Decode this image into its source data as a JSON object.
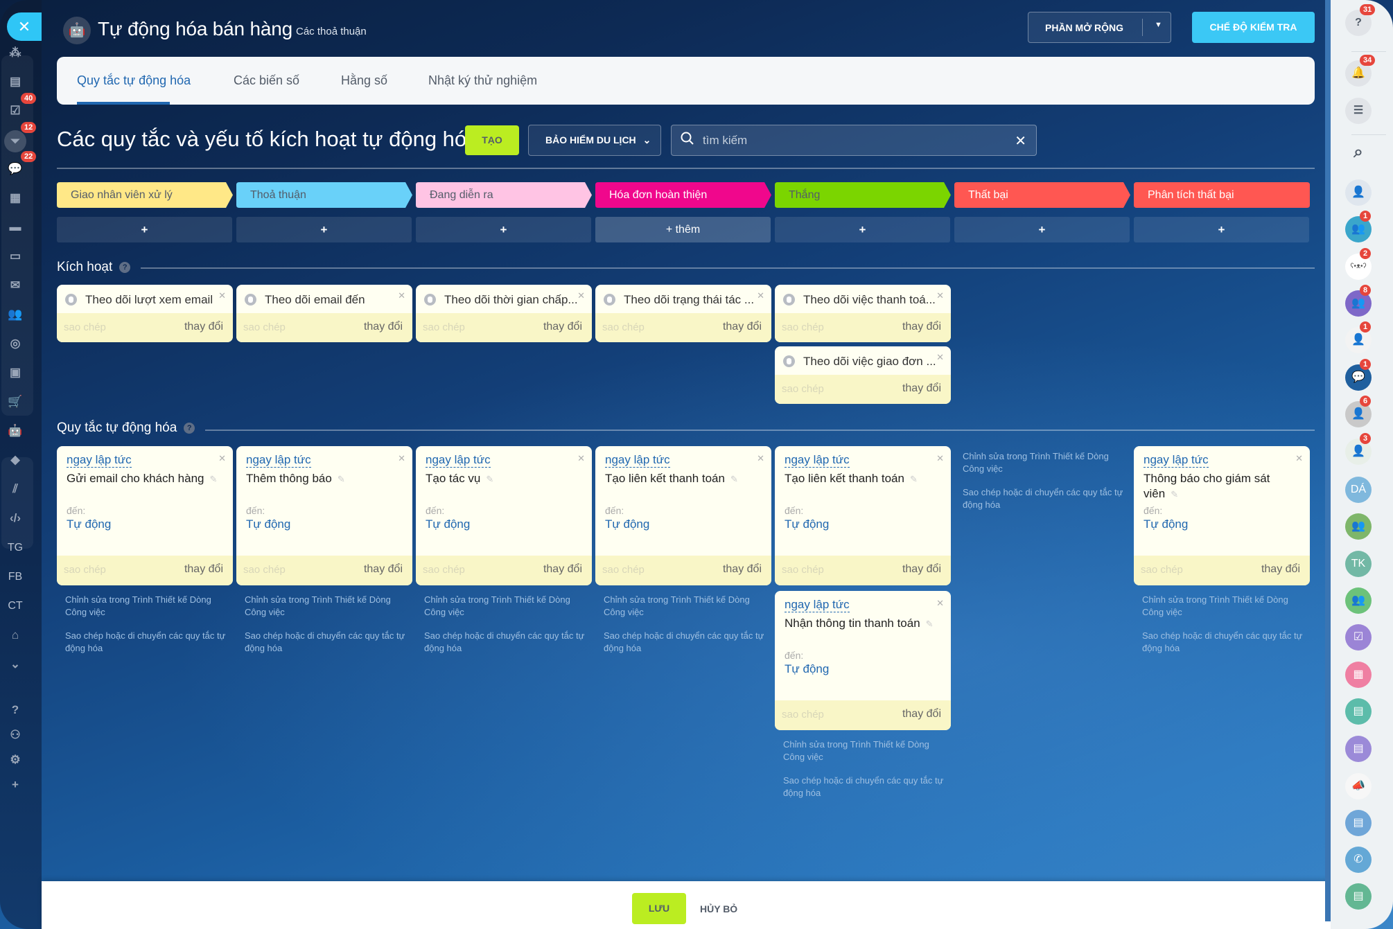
{
  "header": {
    "title": "Tự động hóa bán hàng",
    "subtitle": "Các thoả thuận",
    "robot_icon": "robot-icon",
    "extensions_button": "PHẦN MỞ RỘNG",
    "test_mode_button": "CHẾ ĐỘ KIỂM TRA"
  },
  "tabs": [
    {
      "label": "Quy tắc tự động hóa",
      "active": true
    },
    {
      "label": "Các biến số",
      "active": false
    },
    {
      "label": "Hằng số",
      "active": false
    },
    {
      "label": "Nhật ký thử nghiệm",
      "active": false
    }
  ],
  "toolbar": {
    "page_title": "Các quy tắc và yếu tố kích hoạt tự động hóa",
    "create_button": "TẠO",
    "pipeline_dropdown": "BẢO HIỂM DU LỊCH",
    "search_placeholder": "tìm kiếm",
    "search_value": ""
  },
  "stages": [
    {
      "label": "Giao nhân viên xử lý",
      "color": "#ffe887",
      "text_color": "#535c69",
      "add_label": "+"
    },
    {
      "label": "Thoả thuận",
      "color": "#69d1f9",
      "text_color": "#535c69",
      "add_label": "+"
    },
    {
      "label": "Đang diễn ra",
      "color": "#ffc4e4",
      "text_color": "#535c69",
      "add_label": "+"
    },
    {
      "label": "Hóa đơn hoàn thiện",
      "color": "#f0078c",
      "text_color": "#ffffff",
      "add_label": "+ thêm"
    },
    {
      "label": "Thắng",
      "color": "#7bd500",
      "text_color": "#535c69",
      "add_label": "+"
    },
    {
      "label": "Thất bại",
      "color": "#ff5752",
      "text_color": "#ffffff",
      "add_label": "+"
    },
    {
      "label": "Phân tích thất bại",
      "color": "#ff5752",
      "text_color": "#ffffff",
      "add_label": "+"
    }
  ],
  "triggers_section": {
    "title": "Kích hoạt",
    "copy_label": "sao chép",
    "change_label": "thay đổi",
    "cards": [
      {
        "column": 0,
        "row": 0,
        "name": "Theo dõi lượt xem email"
      },
      {
        "column": 1,
        "row": 0,
        "name": "Theo dõi email đến"
      },
      {
        "column": 2,
        "row": 0,
        "name": "Theo dõi thời gian chấp..."
      },
      {
        "column": 3,
        "row": 0,
        "name": "Theo dõi trạng thái tác ..."
      },
      {
        "column": 4,
        "row": 0,
        "name": "Theo dõi việc thanh toá..."
      },
      {
        "column": 4,
        "row": 1,
        "name": "Theo dõi việc giao đơn ..."
      }
    ]
  },
  "rules_section": {
    "title": "Quy tắc tự động hóa",
    "when_label": "ngay lập tức",
    "to_label": "đến:",
    "to_value": "Tự động",
    "copy_label": "sao chép",
    "change_label": "thay đổi",
    "note_edit": "Chỉnh sửa trong Trình Thiết kế Dòng Công việc",
    "note_copy": "Sao chép hoặc di chuyển các quy tắc tự động hóa",
    "cards": [
      {
        "column": 0,
        "row": 0,
        "name": "Gửi email cho khách hàng"
      },
      {
        "column": 1,
        "row": 0,
        "name": "Thêm thông báo"
      },
      {
        "column": 2,
        "row": 0,
        "name": "Tạo tác vụ"
      },
      {
        "column": 3,
        "row": 0,
        "name": "Tạo liên kết thanh toán"
      },
      {
        "column": 4,
        "row": 0,
        "name": "Tạo liên kết thanh toán"
      },
      {
        "column": 4,
        "row": 1,
        "name": "Nhận thông tin thanh toán"
      },
      {
        "column": 6,
        "row": 0,
        "name": "Thông báo cho giám sát viên"
      }
    ]
  },
  "footer": {
    "save_button": "LƯU",
    "cancel_button": "HỦY BỎ"
  },
  "left_sidebar": {
    "items": [
      {
        "icon": "sitemap-icon"
      },
      {
        "icon": "feed-icon"
      },
      {
        "icon": "tasks-icon",
        "badge": "40"
      },
      {
        "icon": "crm-funnel-icon",
        "badge": "12",
        "active": true
      },
      {
        "icon": "chat-icon",
        "badge": "22"
      },
      {
        "icon": "calendar-icon"
      },
      {
        "icon": "documents-icon"
      },
      {
        "icon": "drive-icon"
      },
      {
        "icon": "mail-icon"
      },
      {
        "icon": "employees-icon"
      },
      {
        "icon": "target-icon"
      },
      {
        "icon": "contact-card-icon"
      },
      {
        "icon": "cart-icon"
      },
      {
        "icon": "robot-icon"
      },
      {
        "icon": "box-icon"
      },
      {
        "icon": "slashes-icon"
      },
      {
        "icon": "code-icon"
      },
      {
        "label": "TG"
      },
      {
        "label": "FB"
      },
      {
        "label": "CT"
      },
      {
        "icon": "bank-icon"
      },
      {
        "icon": "more-icon"
      },
      {
        "icon": "help-icon"
      },
      {
        "icon": "structure-icon"
      },
      {
        "icon": "settings-icon"
      },
      {
        "icon": "add-icon"
      }
    ]
  },
  "right_sidebar": {
    "items": [
      {
        "icon": "help-icon",
        "badge": "31"
      },
      {
        "icon": "bell-icon",
        "badge": "34"
      },
      {
        "icon": "open-lines-icon"
      },
      {
        "icon": "search-icon"
      },
      {
        "icon": "avatar-user",
        "color": "#dfe6ee"
      },
      {
        "icon": "group-icon",
        "color": "#3aa6cb",
        "badge": "1"
      },
      {
        "icon": "bear-avatar",
        "color": "#ffffff",
        "badge": "2"
      },
      {
        "icon": "group-icon",
        "color": "#7e68c8",
        "badge": "8"
      },
      {
        "icon": "avatar-user",
        "color": "#f3f3f3",
        "badge": "1"
      },
      {
        "icon": "group-chat-icon",
        "color": "#1f5f9e",
        "badge": "1"
      },
      {
        "icon": "avatar-user",
        "color": "#c9c9c9",
        "badge": "6"
      },
      {
        "icon": "avatar-user",
        "color": "#e8efe8",
        "badge": "3"
      },
      {
        "label": "DÁ",
        "color": "#7fb8dd"
      },
      {
        "icon": "group-icon",
        "color": "#7eb66a"
      },
      {
        "label": "TK",
        "color": "#72b8a5"
      },
      {
        "icon": "group-icon",
        "color": "#6cc27a"
      },
      {
        "icon": "tasks-icon",
        "color": "#9b84d6"
      },
      {
        "icon": "calendar-icon",
        "color": "#ef7fa2"
      },
      {
        "icon": "contact-center-icon",
        "color": "#5cbcaa"
      },
      {
        "icon": "contact-center-icon",
        "color": "#9b8ad8"
      },
      {
        "icon": "megaphone-icon",
        "color": "#f7f7f7"
      },
      {
        "icon": "contact-center-icon",
        "color": "#6fa6d8"
      },
      {
        "icon": "phone-icon",
        "color": "#64a8d6"
      },
      {
        "icon": "contact-center-icon",
        "color": "#63b793"
      }
    ]
  }
}
